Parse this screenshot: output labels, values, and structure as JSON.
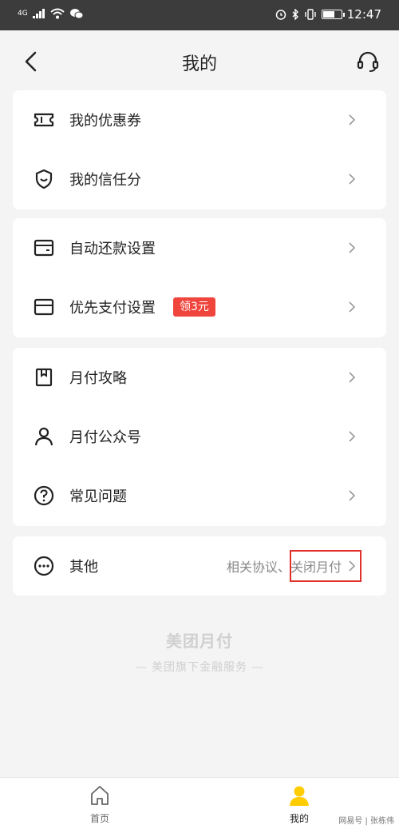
{
  "status_bar": {
    "time": "12:47",
    "network": "4G"
  },
  "header": {
    "title": "我的"
  },
  "groups": [
    {
      "items": [
        {
          "label": "我的优惠券"
        },
        {
          "label": "我的信任分"
        }
      ]
    },
    {
      "items": [
        {
          "label": "自动还款设置"
        },
        {
          "label": "优先支付设置",
          "badge": "领3元"
        }
      ]
    },
    {
      "items": [
        {
          "label": "月付攻略"
        },
        {
          "label": "月付公众号"
        },
        {
          "label": "常见问题"
        }
      ]
    }
  ],
  "other": {
    "label": "其他",
    "links": "相关协议、关闭月付"
  },
  "footer": {
    "brand": "美团月付",
    "tagline": "— 美团旗下金融服务 —"
  },
  "tabs": [
    {
      "label": "首页"
    },
    {
      "label": "我的"
    }
  ],
  "watermark": "网易号 | 张栋伟",
  "colors": {
    "accent": "#ffcc00",
    "badge": "#f0453c",
    "highlight": "#e0302a"
  }
}
